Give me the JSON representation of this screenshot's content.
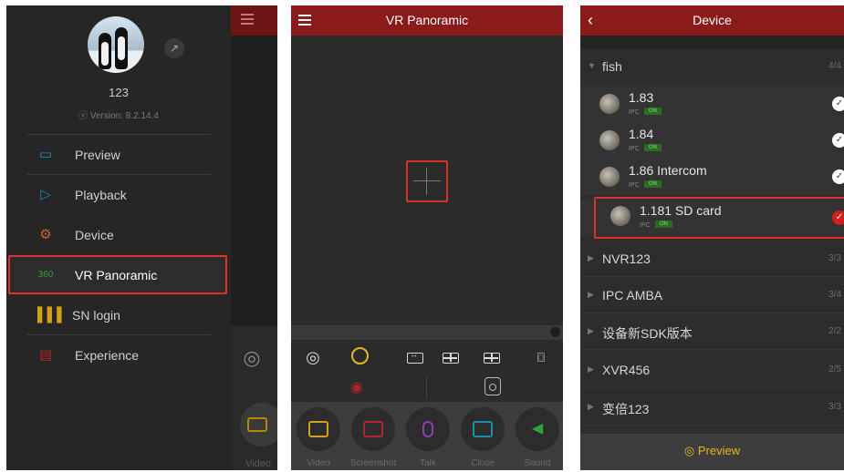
{
  "menu": {
    "username": "123",
    "version": "Version: 8.2.14.4",
    "items": [
      {
        "label": "Preview",
        "icon": "preview-camera-icon",
        "color": "#1e8fa8"
      },
      {
        "label": "Playback",
        "icon": "playback-icon",
        "color": "#1e8fa8"
      },
      {
        "label": "Device",
        "icon": "gear-icon",
        "color": "#c8612a"
      },
      {
        "label": "VR Panoramic",
        "icon": "vr-360-icon",
        "color": "#3e9c3e"
      },
      {
        "label": "SN login",
        "icon": "barcode-icon",
        "color": "#d4a017"
      },
      {
        "label": "Experience",
        "icon": "experience-icon",
        "color": "#b0252a"
      }
    ],
    "background_label": "Video"
  },
  "vr": {
    "title": "VR Panoramic",
    "controls": [
      {
        "label": "Video",
        "icon": "record-video-icon",
        "color": "#d4a017"
      },
      {
        "label": "Screenshot",
        "icon": "screenshot-icon",
        "color": "#b0252a"
      },
      {
        "label": "Talk",
        "icon": "microphone-icon",
        "color": "#8e3fb0"
      },
      {
        "label": "Close",
        "icon": "close-video-icon",
        "color": "#1e8fa8"
      },
      {
        "label": "Sound",
        "icon": "speaker-mute-icon",
        "color": "#2ea43a"
      }
    ]
  },
  "device": {
    "title": "Device",
    "groups": [
      {
        "name": "fish",
        "count": "4/4"
      },
      {
        "name": "NVR123",
        "count": "3/3"
      },
      {
        "name": "IPC AMBA",
        "count": "3/4"
      },
      {
        "name": "设备新SDK版本",
        "count": "2/2"
      },
      {
        "name": "XVR456",
        "count": "2/5"
      },
      {
        "name": "变倍123",
        "count": "3/3"
      }
    ],
    "devices": [
      {
        "name": "1.83",
        "type": "IPC",
        "status": "ON"
      },
      {
        "name": "1.84",
        "type": "IPC",
        "status": "ON"
      },
      {
        "name": "1.86 Intercom",
        "type": "IPC",
        "status": "ON"
      },
      {
        "name": "1.181 SD card",
        "type": "IPC",
        "status": "ON"
      }
    ],
    "preview_label": "Preview"
  }
}
